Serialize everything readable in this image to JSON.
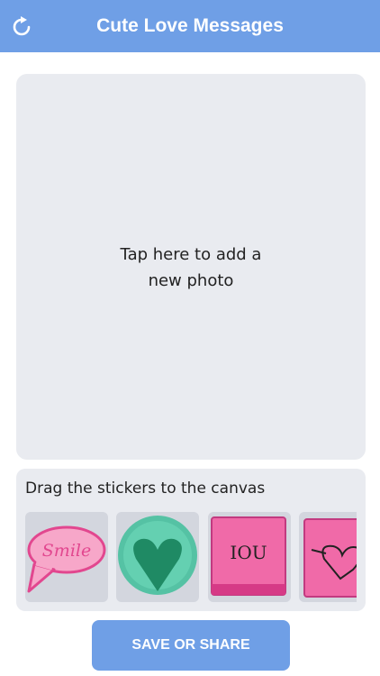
{
  "header": {
    "title": "Cute Love Messages",
    "refresh_icon": "refresh-icon",
    "background_color": "#6f9fe6"
  },
  "canvas": {
    "placeholder_line1": "Tap here to add a",
    "placeholder_line2": "new photo"
  },
  "stickers": {
    "title": "Drag the stickers to the canvas",
    "items": [
      {
        "name": "smile-speech-bubble-sticker",
        "text": "Smile"
      },
      {
        "name": "green-heart-sticker"
      },
      {
        "name": "pink-note-iou-sticker",
        "text": "IOU"
      },
      {
        "name": "pink-note-arrow-heart-sticker"
      }
    ]
  },
  "footer": {
    "save_label": "SAVE OR SHARE"
  }
}
